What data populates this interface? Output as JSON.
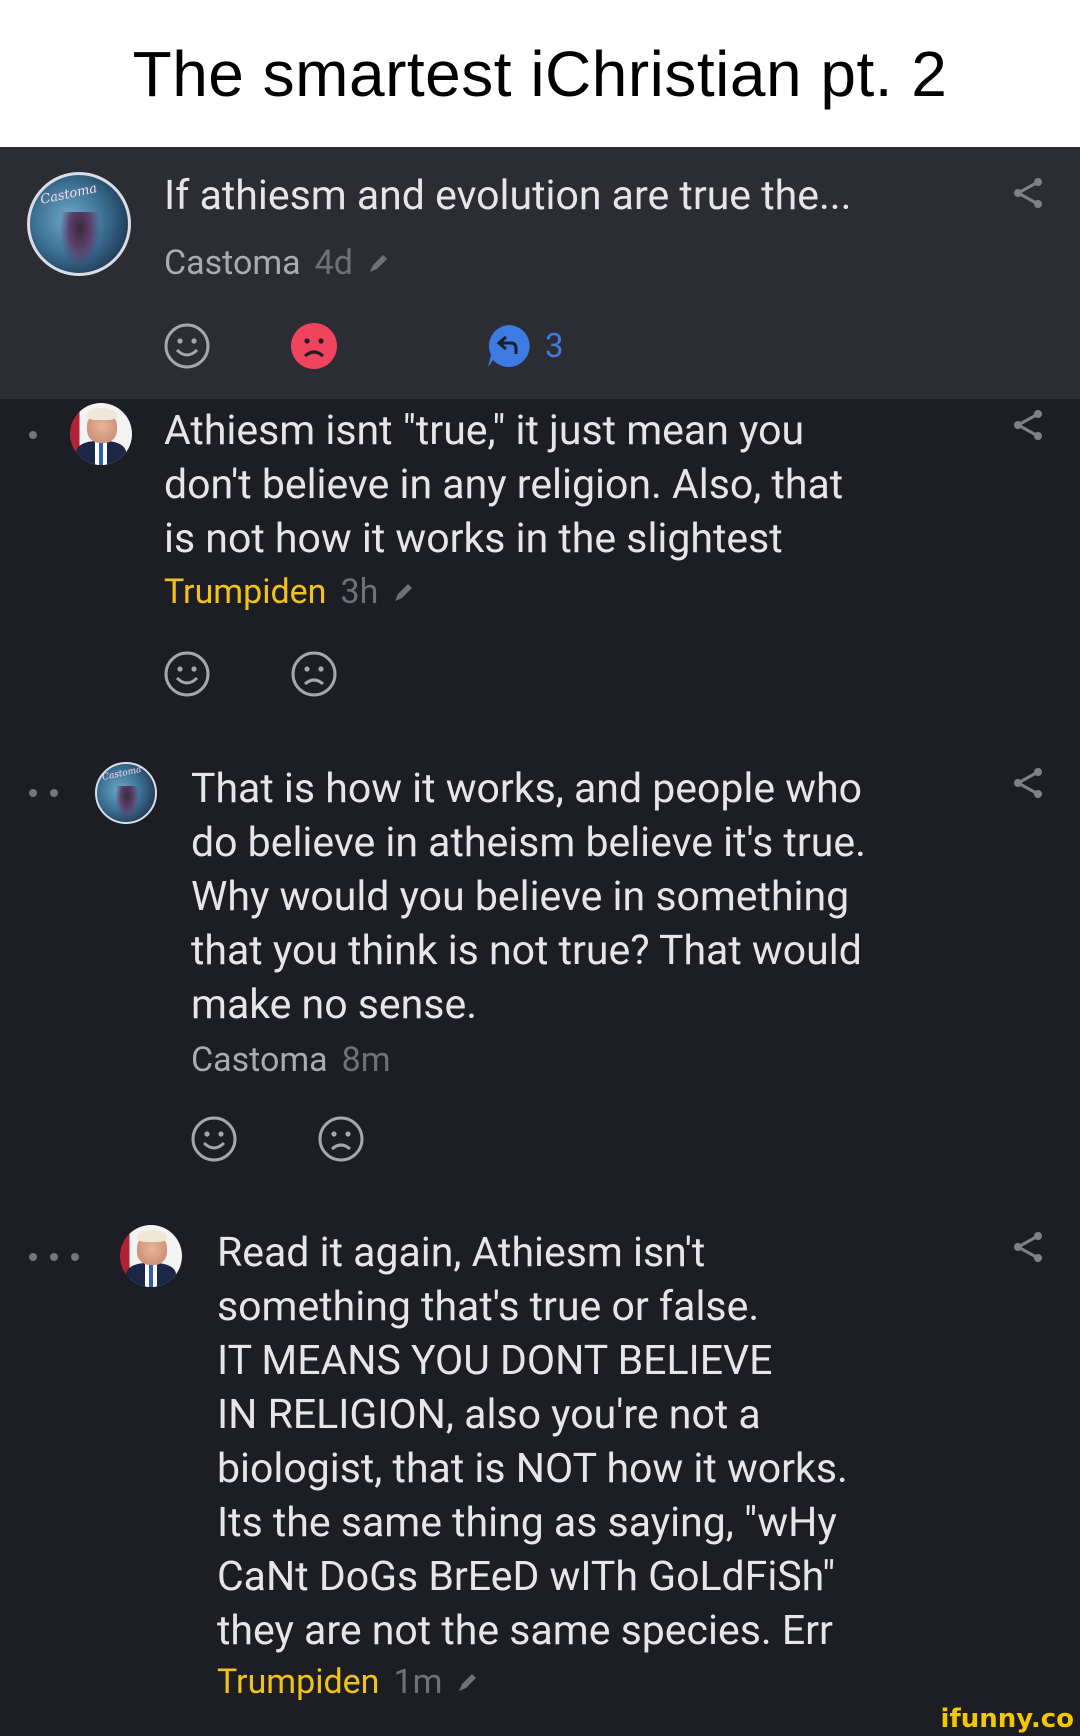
{
  "title": "The smartest iChristian pt. 2",
  "post": {
    "text": "If athiesm and evolution are true the...",
    "author": "Castoma",
    "time": "4d",
    "reply_count": "3"
  },
  "comments": [
    {
      "text": "Athiesm isnt \"true,\" it just mean you\ndon't believe in any religion. Also, that\nis not how it works in the slightest",
      "author": "Trumpiden",
      "time": "3h"
    },
    {
      "text": "That is how it works, and people who\ndo believe in atheism believe it's true.\nWhy would you believe in something\nthat you think is not true? That would\nmake no sense.",
      "author": "Castoma",
      "time": "8m"
    },
    {
      "text": "Read it again, Athiesm isn't\nsomething that's true or false.\nIT MEANS YOU DONT BELIEVE\nIN RELIGION, also you're not a\nbiologist, that is NOT how it works.\nIts the same thing as saying, \"wHy\nCaNt DoGs BrEeD wITh GoLdFiSh\"\nthey are not the same species. Err",
      "author": "Trumpiden",
      "time": "1m"
    }
  ],
  "watermark": "ifunny.co",
  "avatar_castoma_text": "Castoma",
  "colors": {
    "accent_gold": "#f2c21a",
    "reply_blue": "#3d7be3",
    "dislike_red": "#f0435d",
    "post_bg": "#2b2d33",
    "page_bg": "#1c1e24"
  },
  "icons": [
    "smile-icon",
    "sad-icon",
    "reply-icon",
    "share-icon",
    "pencil-icon"
  ]
}
